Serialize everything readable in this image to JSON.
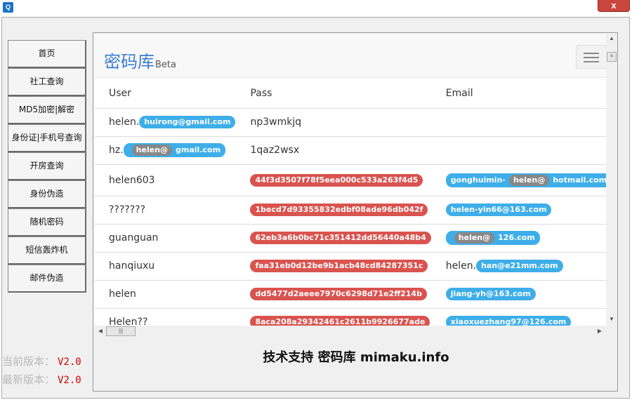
{
  "window": {
    "app_icon": "app-icon",
    "close_glyph": "x"
  },
  "sidebar": {
    "items": [
      {
        "label": "首页"
      },
      {
        "label": "社工查询"
      },
      {
        "label": "MD5加密|解密"
      },
      {
        "label": "身份证|手机号查询"
      },
      {
        "label": "开房查询"
      },
      {
        "label": "身份伪造"
      },
      {
        "label": "随机密码"
      },
      {
        "label": "短信轰炸机"
      },
      {
        "label": "邮件伪造"
      }
    ],
    "current_version_label": "当前版本：",
    "current_version": "V2.0",
    "latest_version_label": "最新版本：",
    "latest_version": "V2.0"
  },
  "web": {
    "brand": "密码库",
    "brand_sub": "Beta",
    "columns": [
      "User",
      "Pass",
      "Email"
    ],
    "rows": [
      {
        "user_prefix": "helen.",
        "user_badge": "huirong@gmail.com",
        "pass": "np3wmkjq",
        "email": ""
      },
      {
        "user_prefix": "hz.",
        "user_badge_gray": "helen@",
        "user_badge_suffix": "gmail.com",
        "pass": "1qaz2wsx",
        "email": ""
      },
      {
        "user": "helen603",
        "pass_badge": "44f3d3507f78f5eea000c533a263f4d5",
        "email_prefix": "gonghuimin-",
        "email_gray": "helen@",
        "email_suffix": "hotmail.com"
      },
      {
        "user": "???????",
        "pass_badge": "1becd7d93355832edbf08ade96db042f",
        "email_badge": "helen-yin66@163.com"
      },
      {
        "user": "guanguan",
        "pass_badge": "62eb3a6b0bc71c351412dd56440a48b4",
        "email_gray": "helen@",
        "email_suffix": "126.com"
      },
      {
        "user": "hanqiuxu",
        "pass_badge": "faa31eb0d12be9b1acb48cd84287351c",
        "email_text": "helen.",
        "email_badge": "han@e21mm.com"
      },
      {
        "user": "helen",
        "pass_badge": "dd5477d2aeee7970c6298d71e2ff214b",
        "email_badge": "jiang-yh@163.com"
      },
      {
        "user": "Helen??",
        "pass_badge": "8aca208a29342461c2611b9926677ade",
        "email_badge": "xiaoxuezhang97@126.com"
      }
    ]
  },
  "footer": {
    "text": "技术支持 密码库 mimaku.info"
  }
}
